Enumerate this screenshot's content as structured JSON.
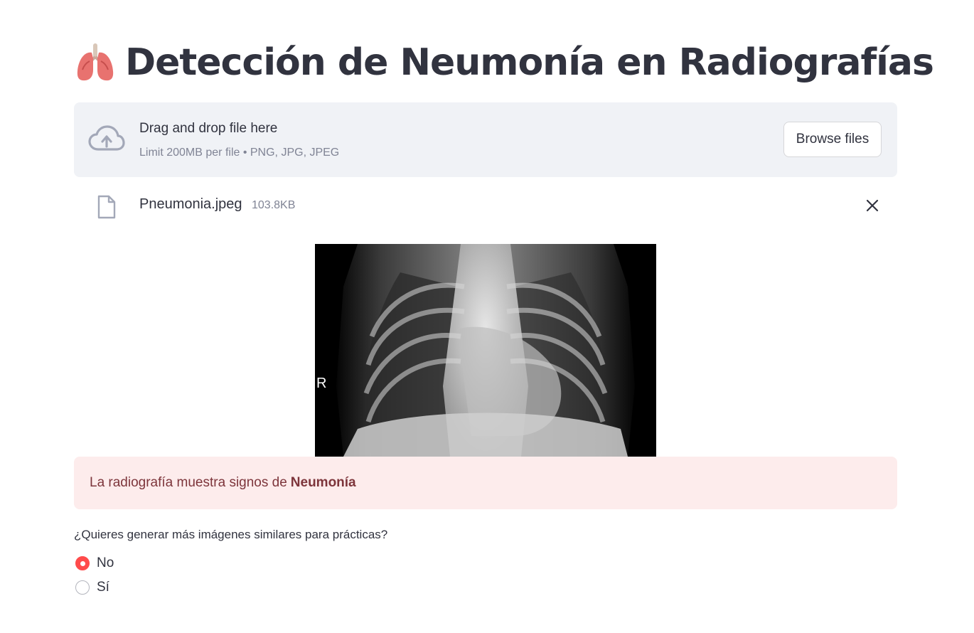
{
  "page": {
    "title": "Detección de Neumonía en Radiografías",
    "title_icon": "lungs-icon"
  },
  "uploader": {
    "drop_label": "Drag and drop file here",
    "limit_text": "Limit 200MB per file • PNG, JPG, JPEG",
    "browse_label": "Browse files",
    "upload_icon": "cloud-upload-icon"
  },
  "uploaded_file": {
    "name": "Pneumonia.jpeg",
    "size": "103.8KB",
    "file_icon": "file-icon",
    "remove_icon": "close-icon"
  },
  "xray_image": {
    "marker": "R"
  },
  "result": {
    "prefix": "La radiografía muestra signos de",
    "diagnosis": "Neumonía",
    "background_color": "#fdecec",
    "text_color": "#7d353b"
  },
  "question": {
    "label": "¿Quieres generar más imágenes similares para prácticas?",
    "options": [
      {
        "label": "No",
        "selected": true
      },
      {
        "label": "Sí",
        "selected": false
      }
    ],
    "accent_color": "#ff4b4b"
  }
}
